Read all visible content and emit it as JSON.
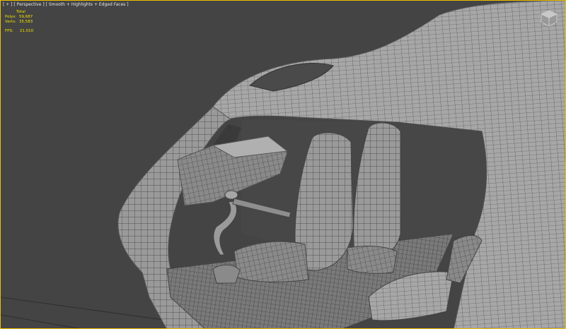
{
  "viewport": {
    "label": "[ + ] [ Perspective ] [ Smooth + Highlights + Edged Faces ]"
  },
  "stats": {
    "header": "Total",
    "rows": [
      {
        "label": "Polys:",
        "value": "59,687"
      },
      {
        "label": "Verts:",
        "value": "35,583"
      }
    ],
    "fps_label": "FPS:",
    "fps_value": "21.010"
  },
  "icons": {
    "viewcube": "viewcube-home-icon"
  },
  "colors": {
    "background": "#444444",
    "stats_text": "#f0e000",
    "border": "#e8c000"
  }
}
